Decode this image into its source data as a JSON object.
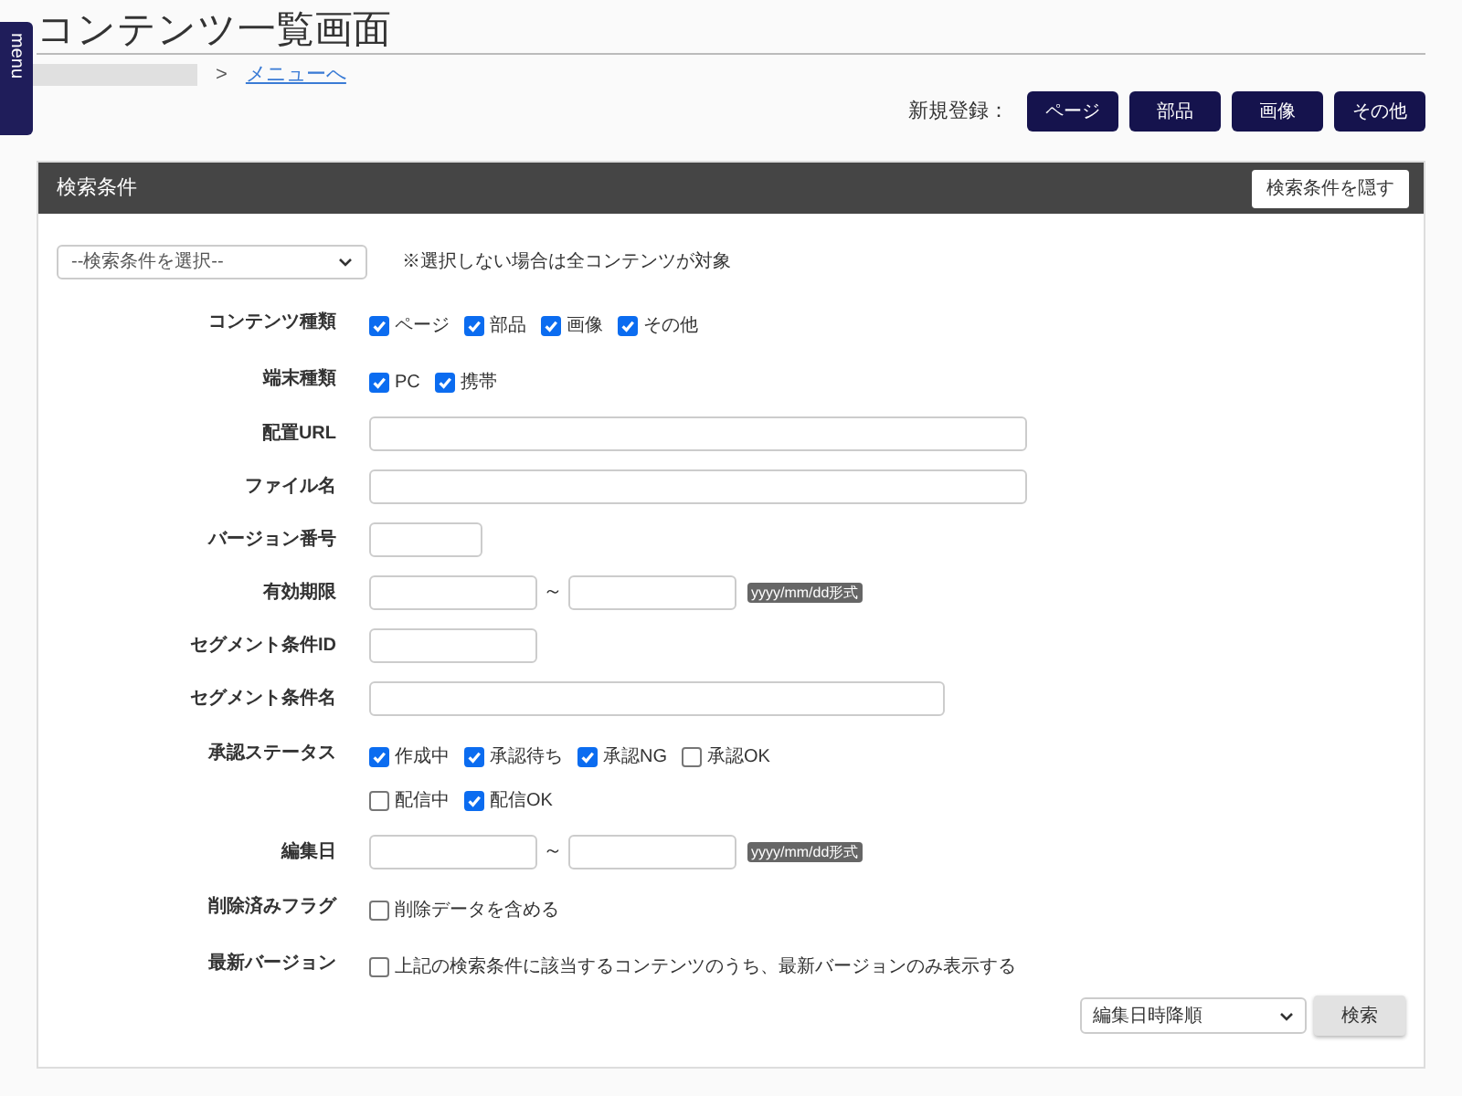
{
  "side_tab": {
    "label": "menu"
  },
  "page_title": "コンテンツ一覧画面",
  "breadcrumb": {
    "separator": ">",
    "link": "メニューへ"
  },
  "new_registration": {
    "label": "新規登録：",
    "buttons": [
      "ページ",
      "部品",
      "画像",
      "その他"
    ]
  },
  "search_panel": {
    "title": "検索条件",
    "hide_button": "検索条件を隠す",
    "preset": {
      "value": "--検索条件を選択--",
      "note": "※選択しない場合は全コンテンツが対象"
    },
    "rows": [
      {
        "kind": "checkboxes",
        "label": "コンテンツ種類",
        "options": [
          {
            "label": "ページ",
            "checked": true
          },
          {
            "label": "部品",
            "checked": true
          },
          {
            "label": "画像",
            "checked": true
          },
          {
            "label": "その他",
            "checked": true
          }
        ]
      },
      {
        "kind": "checkboxes",
        "label": "端末種類",
        "options": [
          {
            "label": "PC",
            "checked": true
          },
          {
            "label": "携帯",
            "checked": true
          }
        ]
      },
      {
        "kind": "text",
        "label": "配置URL"
      },
      {
        "kind": "text",
        "label": "ファイル名"
      },
      {
        "kind": "text",
        "label": "バージョン番号"
      },
      {
        "kind": "date_range",
        "label": "有効期限",
        "separator": "～",
        "hint": "yyyy/mm/dd形式"
      },
      {
        "kind": "text",
        "label": "セグメント条件ID"
      },
      {
        "kind": "text",
        "label": "セグメント条件名"
      },
      {
        "kind": "checkbox_lines",
        "label": "承認ステータス",
        "lines": [
          [
            {
              "label": "作成中",
              "checked": true
            },
            {
              "label": "承認待ち",
              "checked": true
            },
            {
              "label": "承認NG",
              "checked": true
            },
            {
              "label": "承認OK",
              "checked": false
            }
          ],
          [
            {
              "label": "配信中",
              "checked": false
            },
            {
              "label": "配信OK",
              "checked": true
            }
          ]
        ]
      },
      {
        "kind": "date_range",
        "label": "編集日",
        "separator": "～",
        "hint": "yyyy/mm/dd形式"
      },
      {
        "kind": "checkboxes",
        "label": "削除済みフラグ",
        "options": [
          {
            "label": "削除データを含める",
            "checked": false
          }
        ]
      },
      {
        "kind": "checkboxes",
        "label": "最新バージョン",
        "options": [
          {
            "label": "上記の検索条件に該当するコンテンツのうち、最新バージョンのみ表示する",
            "checked": false
          }
        ]
      }
    ],
    "sort": {
      "value": "編集日時降順"
    },
    "search_button": "検索"
  }
}
